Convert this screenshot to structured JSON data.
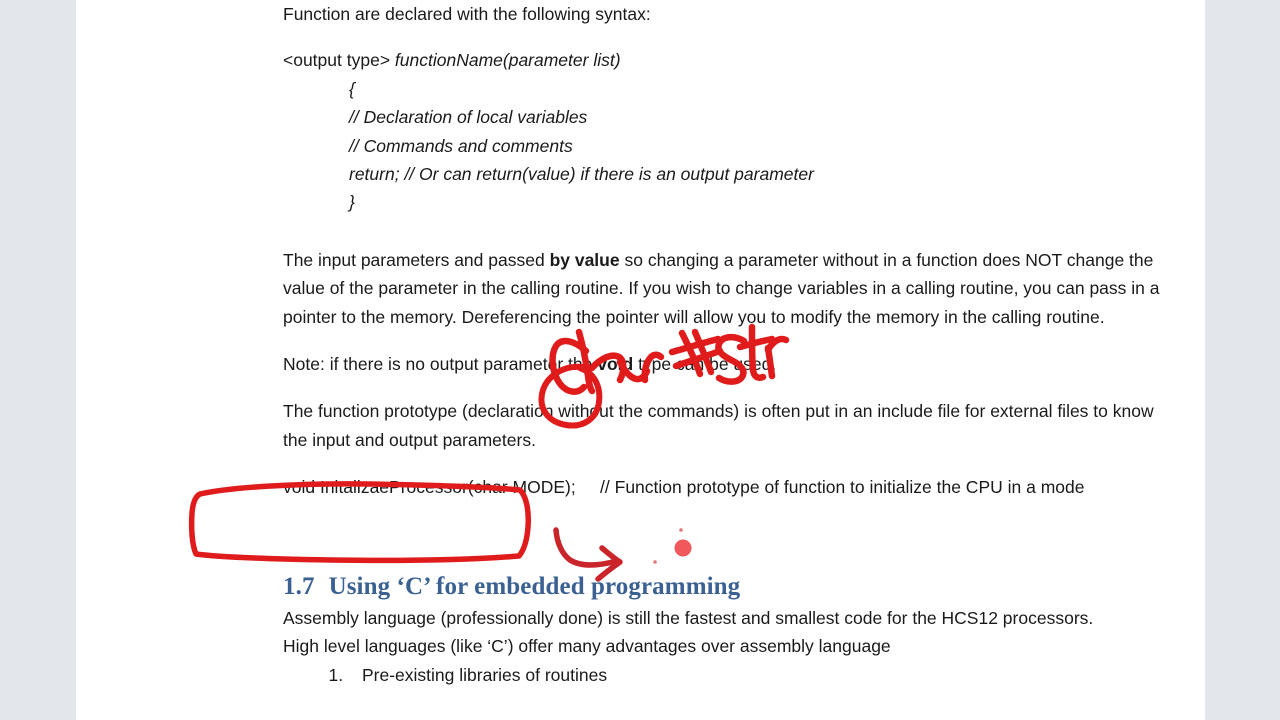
{
  "page": {
    "background_color": "#e4e7ea",
    "sheet_color": "#ffffff",
    "text_color": "#1a1a1a"
  },
  "document": {
    "intro_line": "Function are declared with the following syntax:",
    "syntax_block": {
      "signature_prefix": "<output type> ",
      "signature_italic": "functionName(parameter list)",
      "lines": [
        "{",
        "// Declaration of local variables",
        "// Commands and comments",
        "return;  // Or can return(value) if there is an output parameter",
        "}"
      ]
    },
    "paragraph_by_value": {
      "part1": "The input parameters and passed ",
      "bold": "by value",
      "part2": " so changing a parameter without in a function does NOT change the value of the parameter in the calling routine.  If you wish to change variables in a calling routine, you can pass in a pointer to the memory.  Dereferencing the pointer will allow you to modify the memory in the calling routine."
    },
    "note_void": {
      "part1": "Note: if there is no output parameter the ",
      "bold": "void",
      "part2": " type can be used."
    },
    "paragraph_prototype": "The function prototype (declaration without the commands) is often put in an include file for external files to know the input and output parameters.",
    "prototype_code": "void InitalizaeProcessor(char MODE);",
    "prototype_comment": "// Function prototype of function to initialize the CPU in a mode",
    "section": {
      "number": "1.7",
      "title": "Using ‘C’ for embedded programming",
      "color": "#3a6192"
    },
    "paragraph_assembly_line1": "Assembly language (professionally done) is still the fastest and smallest code for the HCS12 processors.",
    "paragraph_assembly_line2": "High level languages (like ‘C’) offer many advantages over assembly language",
    "list_items": [
      "Pre-existing libraries of routines"
    ]
  },
  "annotations": {
    "ink_color": "#e01b1b",
    "dot_color": "#f0585c",
    "handwriting_text": "char *str",
    "items": [
      {
        "name": "handwritten-char-str",
        "kind": "handwriting",
        "text": "char *str"
      },
      {
        "name": "circle-around-void",
        "kind": "ellipse"
      },
      {
        "name": "box-around-prototype",
        "kind": "rounded-rectangle"
      },
      {
        "name": "arrow-under-prototype",
        "kind": "arrow"
      },
      {
        "name": "ink-dot",
        "kind": "dot"
      }
    ]
  }
}
